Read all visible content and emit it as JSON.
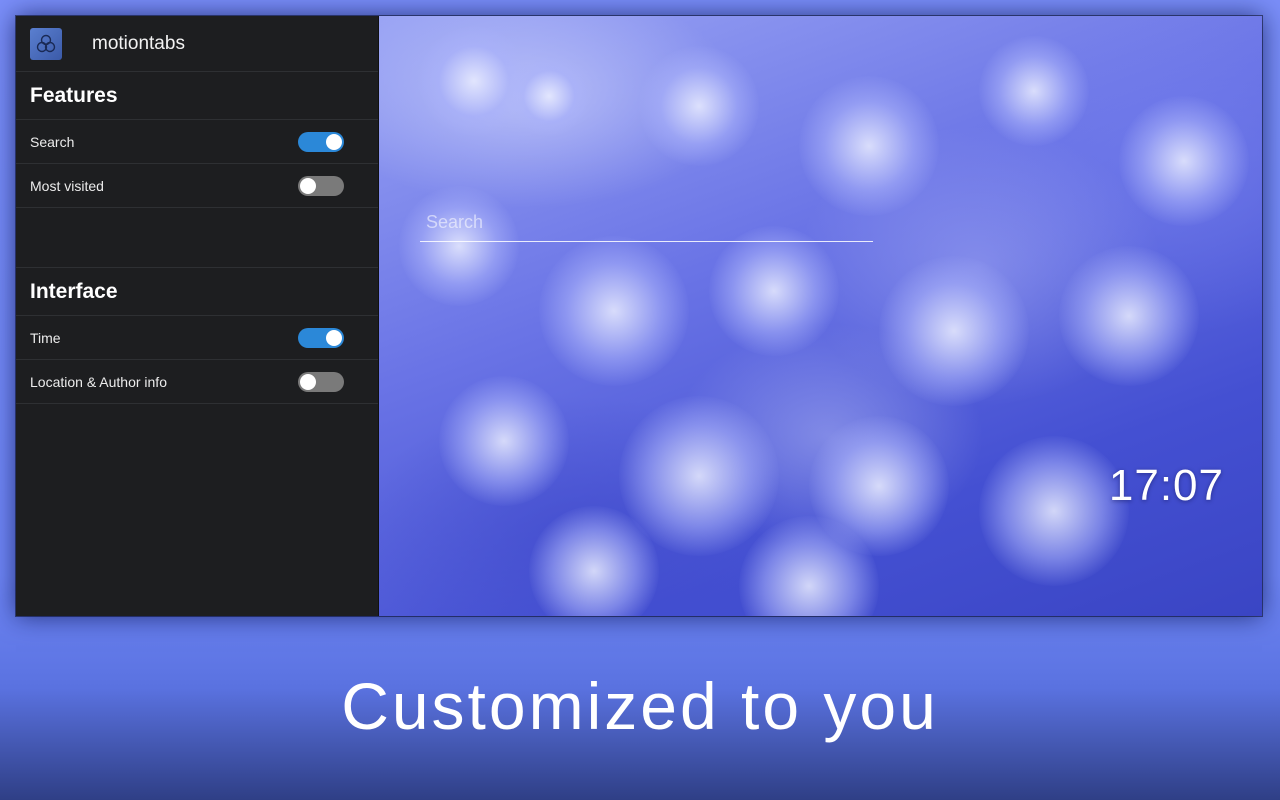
{
  "app": {
    "name": "motiontabs",
    "logo_icon": "hexagon-cluster-icon"
  },
  "sidebar": {
    "features_title": "Features",
    "features": [
      {
        "label": "Search",
        "enabled": true
      },
      {
        "label": "Most visited",
        "enabled": false
      }
    ],
    "interface_title": "Interface",
    "interface": [
      {
        "label": "Time",
        "enabled": true
      },
      {
        "label": "Location & Author info",
        "enabled": false
      }
    ]
  },
  "preview": {
    "search_placeholder": "Search",
    "time": "17:07"
  },
  "tagline": "Customized to you",
  "colors": {
    "background": "#7a8ef8",
    "sidebar": "#1d1e20",
    "toggle_on": "#2b88d8",
    "toggle_off": "#7a7a7a"
  }
}
